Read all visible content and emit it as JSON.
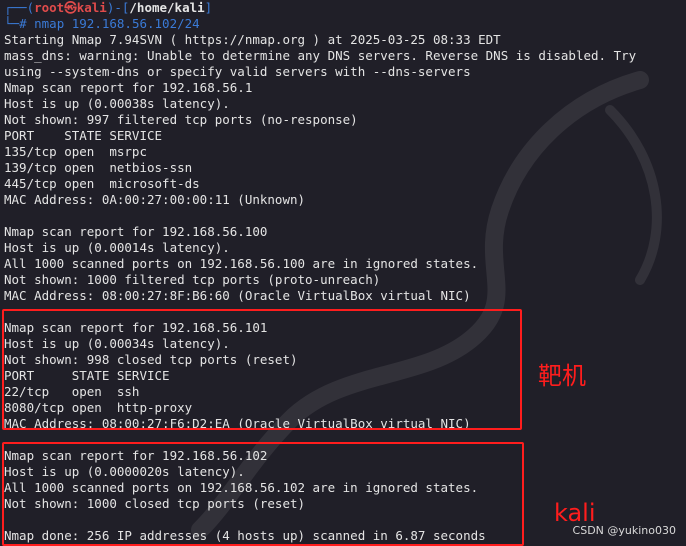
{
  "prompt": {
    "top_left": "┌──(",
    "user": "root㉿kali",
    "mid": ")-[",
    "path": "/home/kali",
    "end": "]",
    "bottom_left": "└─",
    "hash": "#",
    "command": " nmap 192.168.56.102/24"
  },
  "output_lines": [
    "Starting Nmap 7.94SVN ( https://nmap.org ) at 2025-03-25 08:33 EDT",
    "mass_dns: warning: Unable to determine any DNS servers. Reverse DNS is disabled. Try",
    "using --system-dns or specify valid servers with --dns-servers",
    "Nmap scan report for 192.168.56.1",
    "Host is up (0.00038s latency).",
    "Not shown: 997 filtered tcp ports (no-response)",
    "PORT    STATE SERVICE",
    "135/tcp open  msrpc",
    "139/tcp open  netbios-ssn",
    "445/tcp open  microsoft-ds",
    "MAC Address: 0A:00:27:00:00:11 (Unknown)",
    "",
    "Nmap scan report for 192.168.56.100",
    "Host is up (0.00014s latency).",
    "All 1000 scanned ports on 192.168.56.100 are in ignored states.",
    "Not shown: 1000 filtered tcp ports (proto-unreach)",
    "MAC Address: 08:00:27:8F:B6:60 (Oracle VirtualBox virtual NIC)",
    "",
    "Nmap scan report for 192.168.56.101",
    "Host is up (0.00034s latency).",
    "Not shown: 998 closed tcp ports (reset)",
    "PORT     STATE SERVICE",
    "22/tcp   open  ssh",
    "8080/tcp open  http-proxy",
    "MAC Address: 08:00:27:F6:D2:EA (Oracle VirtualBox virtual NIC)",
    "",
    "Nmap scan report for 192.168.56.102",
    "Host is up (0.0000020s latency).",
    "All 1000 scanned ports on 192.168.56.102 are in ignored states.",
    "Not shown: 1000 closed tcp ports (reset)",
    "",
    "Nmap done: 256 IP addresses (4 hosts up) scanned in 6.87 seconds"
  ],
  "annotations": {
    "target_label": "靶机",
    "kali_label": "kali",
    "credit": "CSDN @yukino030"
  },
  "colors": {
    "background": "#201f28",
    "text": "#e4e4e4",
    "prompt_blue": "#3a7ad6",
    "prompt_red": "#e04b4b",
    "annotation_red": "#ff1d1d"
  }
}
